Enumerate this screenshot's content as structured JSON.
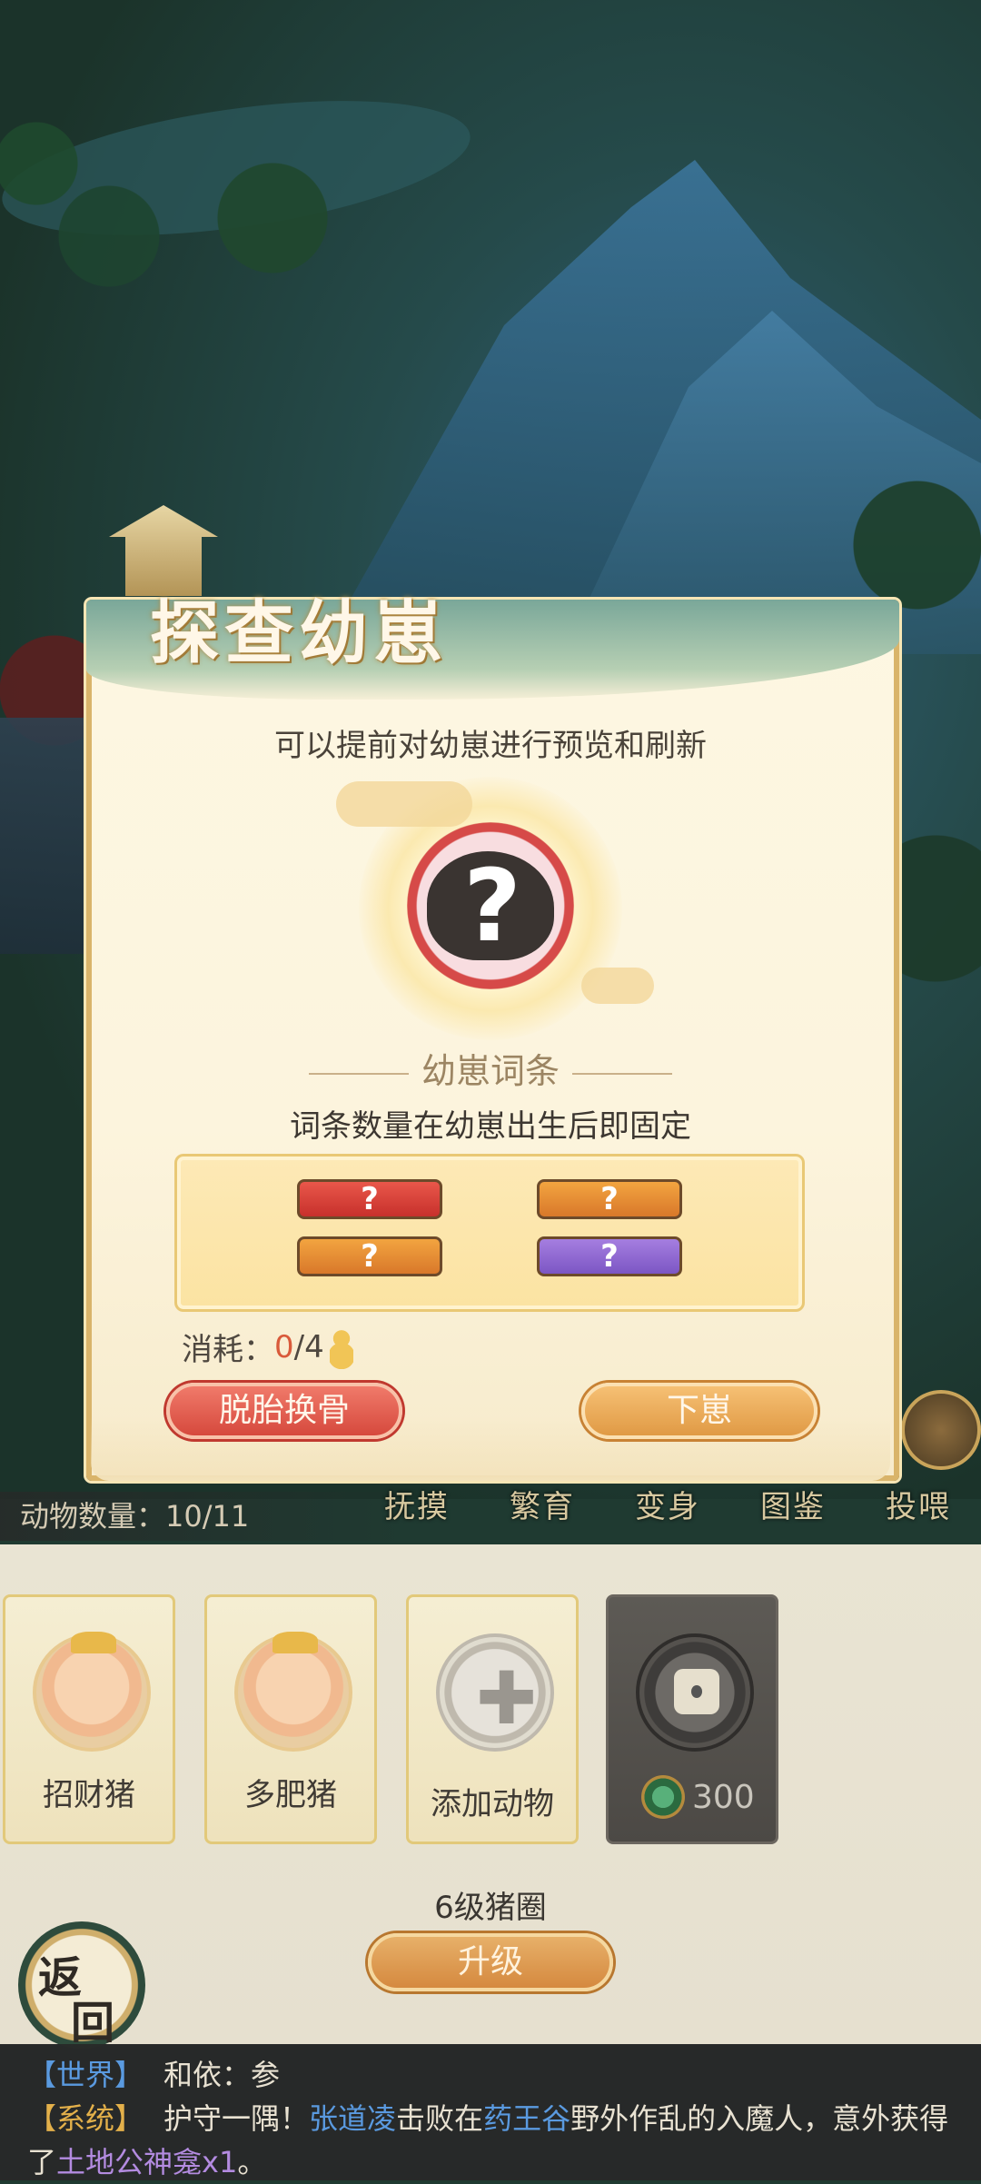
{
  "modal": {
    "title": "探查幼崽",
    "subtitle": "可以提前对幼崽进行预览和刷新",
    "preview_mark": "?",
    "section_title": "幼崽词条",
    "rule_note": "词条数量在幼崽出生后即固定",
    "traits": [
      {
        "label": "?",
        "color": "red"
      },
      {
        "label": "?",
        "color": "orange"
      },
      {
        "label": "?",
        "color": "orange"
      },
      {
        "label": "?",
        "color": "purple"
      }
    ],
    "cost_label": "消耗：",
    "cost_current": "0",
    "cost_total": "/4",
    "reroll_button": "脱胎换骨",
    "birth_button": "下崽"
  },
  "actions": [
    "抚摸",
    "繁育",
    "变身",
    "图鉴",
    "投喂"
  ],
  "animal_count": "动物数量：10/11",
  "slots": [
    {
      "label": "招财猪",
      "type": "animal"
    },
    {
      "label": "多肥猪",
      "type": "animal"
    },
    {
      "label": "添加动物",
      "type": "add"
    },
    {
      "label": "300",
      "type": "locked"
    }
  ],
  "pen_label": "6级猪圈",
  "upgrade_button": "升级",
  "return_button": [
    "返",
    "回"
  ],
  "chat": {
    "line1": {
      "channel": "【世界】",
      "text": "和依：参"
    },
    "line2": {
      "channel": "【系统】",
      "t1": "护守一隅！",
      "name": "张道凌",
      "t2": "击败在",
      "place": "药王谷",
      "t3": "野外作乱的入魔人，意外获得了",
      "item": "土地公神龛x1",
      "t4": "。"
    }
  },
  "colors": {
    "accent_gold": "#d9b46a",
    "red_button": "#d6493d",
    "gold_button": "#e09a45",
    "link_blue": "#5a9ae0",
    "channel_gold": "#e3b04a"
  }
}
